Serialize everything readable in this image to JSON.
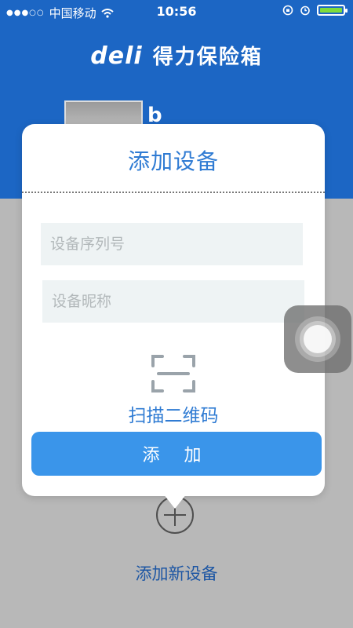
{
  "status_bar": {
    "signal": "●●●○○",
    "carrier": "中国移动",
    "time": "10:56",
    "battery_level": 1.0,
    "icons": [
      "wifi-icon",
      "orientation-lock-icon",
      "alarm-icon",
      "battery-icon"
    ]
  },
  "header": {
    "logo": "deli",
    "app_name": "得力保险箱",
    "background": "#1c66c4",
    "device_name_initial": "b"
  },
  "dialog": {
    "title": "添加设备",
    "serial_placeholder": "设备序列号",
    "nickname_placeholder": "设备昵称",
    "scan_label": "扫描二维码",
    "add_button": "添 加"
  },
  "bottom": {
    "add_new_label": "添加新设备"
  },
  "colors": {
    "accent": "#2f7bd3",
    "button": "#3a95ea",
    "overlay": "#b8b8b8"
  }
}
